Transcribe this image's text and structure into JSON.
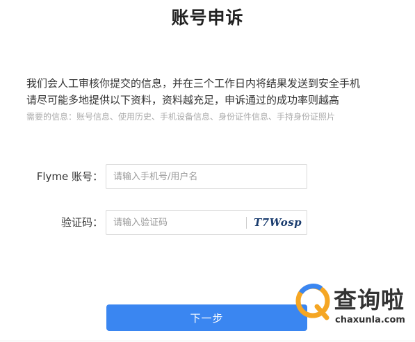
{
  "page": {
    "title": "账号申诉"
  },
  "intro": {
    "line1": "我们会人工审核你提交的信息，并在三个工作日内将结果发送到安全手机",
    "line2": "请尽可能多地提供以下资料，资料越充足，申诉通过的成功率则越高",
    "hint": "需要的信息：账号信息、使用历史、手机设备信息、身份证件信息、手持身份证照片"
  },
  "form": {
    "account": {
      "label": "Flyme 账号：",
      "placeholder": "请输入手机号/用户名",
      "value": ""
    },
    "captcha": {
      "label": "验证码：",
      "placeholder": "请输入验证码",
      "value": "",
      "code": "T7Wosp"
    },
    "next_label": "下一步"
  },
  "watermark": {
    "text": "查询啦",
    "url": "chaxunla.com"
  },
  "colors": {
    "accent": "#3a86f1",
    "hint": "#aaaaaa",
    "captcha": "#1a3c6e"
  },
  "icons": {
    "watermark_logo": "magnifier-q-logo-icon"
  }
}
